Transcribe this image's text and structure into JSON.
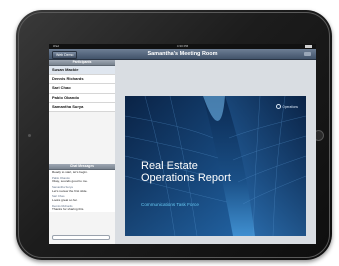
{
  "status_bar": {
    "carrier": "iPad",
    "time": "4:30 PM"
  },
  "nav": {
    "back_label": "Web Demo",
    "title": "Samantha's Meeting Room"
  },
  "sidebar": {
    "participants_header": "Participants",
    "participants": [
      {
        "name": "Susan Mackie"
      },
      {
        "name": "Dennis Richards"
      },
      {
        "name": "Sari Chao"
      },
      {
        "name": "Pablo Obando"
      },
      {
        "name": "Samantha Surya"
      }
    ],
    "chat_header": "Chat Messages",
    "chat": [
      {
        "name": "",
        "text": "Ready to start, let's begin."
      },
      {
        "name": "Pablo Obando",
        "text": "Okay, sounds good to me."
      },
      {
        "name": "Samantha Surya",
        "text": "Let's review the first slide."
      },
      {
        "name": "Sari Chao",
        "text": "Looks great so far."
      },
      {
        "name": "Dennis Richards",
        "text": "Thanks for sharing this."
      }
    ]
  },
  "slide": {
    "title_line1": "Real Estate",
    "title_line2": "Operations Report",
    "subtitle": "Communications Task Force",
    "logo_text": "Operations"
  },
  "colors": {
    "nav_top": "#6e7f95",
    "nav_bottom": "#42536a",
    "slide_bg": "#0a2346",
    "subtitle": "#66c8f2"
  }
}
